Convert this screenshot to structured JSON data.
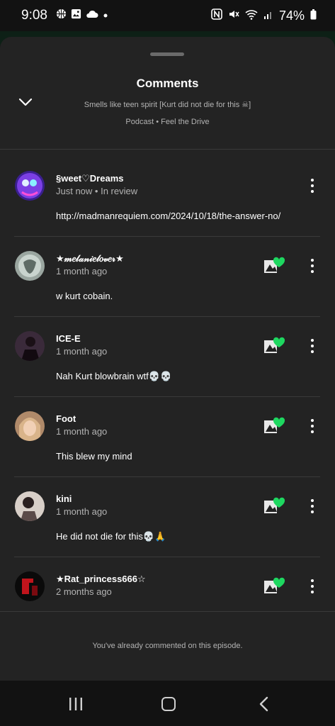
{
  "status_bar": {
    "time": "9:08",
    "battery": "74%"
  },
  "sheet": {
    "title": "Comments",
    "episode_title": "Smells like teen spirit [Kurt did not die for this ☠]",
    "meta": "Podcast • Feel the Drive"
  },
  "comments": [
    {
      "author": "§weet♡Dreams",
      "time": "Just now • In review",
      "text": "http://madmanrequiem.com/2024/10/18/the-answer-no/",
      "liked_by_creator": false
    },
    {
      "author": "★𝓂𝑒𝓁𝒶𝓃𝒾𝑒𝓁𝑜𝓋𝑒𝓇★",
      "time": "1 month ago",
      "text": "w kurt cobain.",
      "liked_by_creator": true
    },
    {
      "author": "ICE-E",
      "time": "1 month ago",
      "text": "Nah Kurt blowbrain wtf💀💀",
      "liked_by_creator": true
    },
    {
      "author": "Foot",
      "time": "1 month ago",
      "text": "This blew my mind",
      "liked_by_creator": true
    },
    {
      "author": "kini",
      "time": "1 month ago",
      "text": "He did not die for this💀🙏",
      "liked_by_creator": true
    },
    {
      "author": "★Rat_princess666☆",
      "time": "2 months ago",
      "text": "",
      "liked_by_creator": true
    }
  ],
  "footer_note": "You've already commented on this episode.",
  "colors": {
    "accent": "#1ed760",
    "sheet": "#232323",
    "muted": "#b3b3b3"
  }
}
